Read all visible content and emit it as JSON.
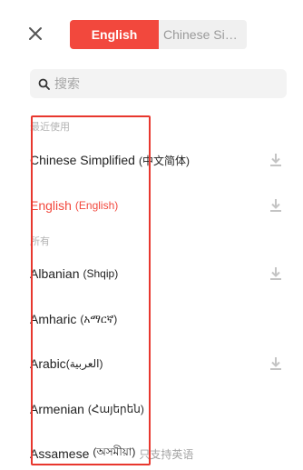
{
  "header": {
    "tabs": [
      {
        "label": "English",
        "active": true
      },
      {
        "label": "Chinese Simplified",
        "active": false
      }
    ]
  },
  "search": {
    "placeholder": "搜索"
  },
  "sections": {
    "recent": "最近使用",
    "all": "所有"
  },
  "languages": {
    "recent": [
      {
        "name": "Chinese Simplified",
        "native": "(中文简体)",
        "downloadable": true
      },
      {
        "name": "English",
        "native": "(English)",
        "selected": true,
        "downloadable": true
      }
    ],
    "all": [
      {
        "name": "Albanian",
        "native": "(Shqip)",
        "downloadable": true
      },
      {
        "name": "Amharic",
        "native": "(አማርኛ)",
        "downloadable": false
      },
      {
        "name": "Arabic",
        "native": "(العربية)",
        "downloadable": true
      },
      {
        "name": "Armenian",
        "native": "(Հայերեն)",
        "downloadable": false
      },
      {
        "name": "Assamese",
        "native": "(অসমীয়া)",
        "note": "只支持英语",
        "downloadable": false
      }
    ]
  },
  "colors": {
    "accent": "#f2483d",
    "highlight_box": "#e8372e",
    "icon_gray": "#c4c4c4"
  }
}
